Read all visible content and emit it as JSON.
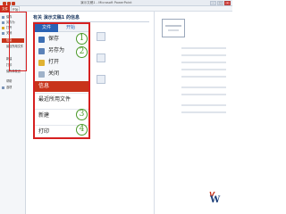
{
  "titlebar": {
    "title": "演示文稿1 - Microsoft PowerPoint"
  },
  "ribbon_tabs": {
    "file": "文件",
    "home": "开始"
  },
  "left_menu": [
    {
      "label": "保存",
      "icon": "save-icon"
    },
    {
      "label": "另存为",
      "icon": "save-as-icon"
    },
    {
      "label": "打开",
      "icon": "open-icon"
    },
    {
      "label": "关闭",
      "icon": "close-doc-icon"
    },
    {
      "label": "信息",
      "icon": ""
    },
    {
      "label": "最近所用文件",
      "icon": ""
    },
    {
      "label": "新建",
      "icon": ""
    },
    {
      "label": "打印",
      "icon": ""
    },
    {
      "label": "保存并发送",
      "icon": ""
    },
    {
      "label": "帮助",
      "icon": ""
    },
    {
      "label": "选项",
      "icon": "options-icon"
    }
  ],
  "main": {
    "heading": "有关 演示文稿1 的信息"
  },
  "callout": {
    "tab_file": "文件",
    "tab_home": "开始",
    "items_top": [
      {
        "label": "保存",
        "number": "1",
        "icon": "save-icon"
      },
      {
        "label": "另存为",
        "number": "2",
        "icon": "save-as-icon"
      },
      {
        "label": "打开",
        "number": "",
        "icon": "open-folder-icon"
      },
      {
        "label": "关闭",
        "number": "",
        "icon": "close-doc-icon"
      }
    ],
    "item_active": "信息",
    "items_bottom": [
      {
        "label": "最近所用文件",
        "number": ""
      },
      {
        "label": "新建",
        "number": "3"
      },
      {
        "label": "打印",
        "number": "4"
      }
    ]
  },
  "colors": {
    "file_tab": "#c8341b",
    "callout_border": "#d62020",
    "number_badge": "#4c9a2a",
    "callout_tab": "#2a63b5"
  }
}
